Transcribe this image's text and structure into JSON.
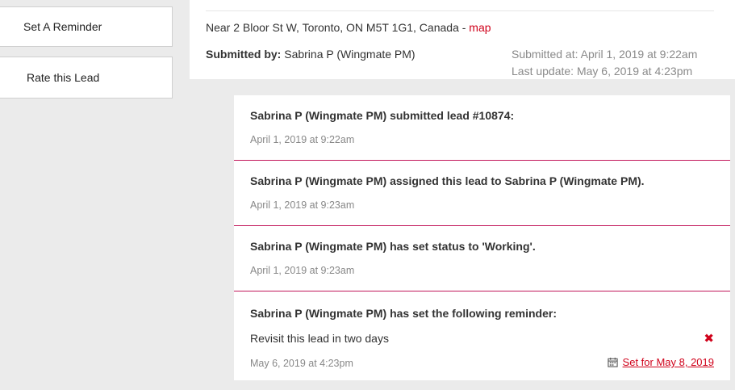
{
  "sidebar": {
    "set_reminder_label": "Set A Reminder",
    "rate_lead_label": "Rate this Lead"
  },
  "lead_info": {
    "address_prefix": "Near 2 Bloor St W, Toronto, ON M5T 1G1, Canada - ",
    "map_link": "map",
    "submitted_by_label": "Submitted by:",
    "submitted_by_value": " Sabrina P (Wingmate PM)",
    "submitted_at": "Submitted at: April 1, 2019 at 9:22am",
    "last_update": "Last update: May 6, 2019 at 4:23pm"
  },
  "feed": {
    "entries": [
      {
        "title": "Sabrina P (Wingmate PM) submitted lead #10874:",
        "time": "April 1, 2019 at 9:22am"
      },
      {
        "title": "Sabrina P (Wingmate PM) assigned this lead to Sabrina P (Wingmate PM).",
        "time": "April 1, 2019 at 9:23am"
      },
      {
        "title": "Sabrina P (Wingmate PM) has set status to 'Working'.",
        "time": "April 1, 2019 at 9:23am"
      },
      {
        "title": "Sabrina P (Wingmate PM) has set the following reminder:",
        "body": "Revisit this lead in two days",
        "time": "May 6, 2019 at 4:23pm",
        "delete_icon": "✖",
        "set_for": "Set for May 8, 2019"
      }
    ]
  },
  "colors": {
    "accent": "#d0021b",
    "divider": "#c2185b",
    "background": "#ebebeb"
  },
  "icons": {
    "delete": "close-x-icon",
    "calendar": "calendar-icon"
  }
}
